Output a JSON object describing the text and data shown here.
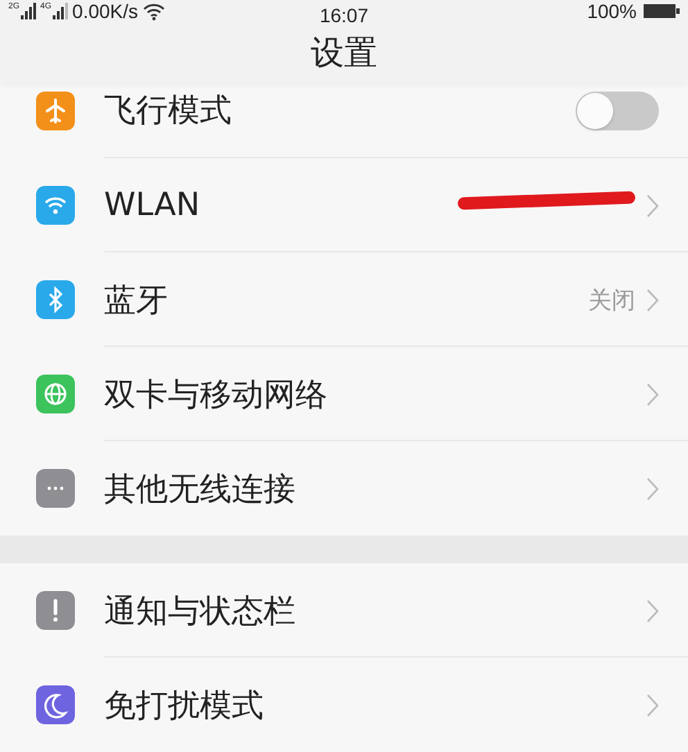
{
  "status_bar": {
    "signal_1": "2G",
    "signal_2": "4G",
    "speed": "0.00K/s",
    "time": "16:07",
    "battery": "100%"
  },
  "title": "设置",
  "sections": [
    {
      "items": [
        {
          "kind": "toggle",
          "color": "#f39019",
          "label": "飞行模式",
          "on": false
        },
        {
          "kind": "link",
          "color": "#2aa9ea",
          "label": "WLAN",
          "redacted": true
        },
        {
          "kind": "link",
          "color": "#2aa9ea",
          "label": "蓝牙",
          "value": "关闭"
        },
        {
          "kind": "link",
          "color": "#3cc35c",
          "label": "双卡与移动网络"
        },
        {
          "kind": "link",
          "color": "#8e8e93",
          "label": "其他无线连接"
        }
      ]
    },
    {
      "items": [
        {
          "kind": "link",
          "color": "#8e8e93",
          "label": "通知与状态栏"
        },
        {
          "kind": "link",
          "color": "#6f64e0",
          "label": "免打扰模式"
        }
      ]
    }
  ]
}
